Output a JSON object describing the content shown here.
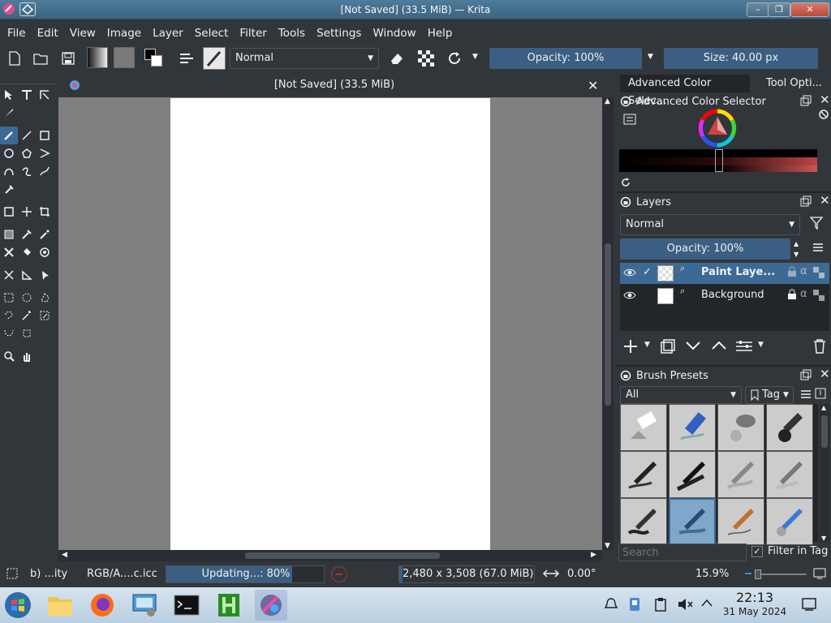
{
  "window": {
    "title": "[Not Saved] (33.5 MiB) — Krita",
    "controls": [
      "–",
      "❐",
      "✕"
    ]
  },
  "menu": [
    "File",
    "Edit",
    "View",
    "Image",
    "Layer",
    "Select",
    "Filter",
    "Tools",
    "Settings",
    "Window",
    "Help"
  ],
  "toolbar": {
    "blend_mode": "Normal",
    "opacity_label": "Opacity: 100%",
    "size_label": "Size: 40.00 px"
  },
  "document": {
    "tab_title": "[Not Saved]  (33.5 MiB)",
    "close": "✕"
  },
  "dockers": {
    "tabs": [
      "Advanced Color Selec...",
      "Tool Opti..."
    ],
    "color_selector_title": "Advanced Color Selector",
    "layers_title": "Layers",
    "layers_blend": "Normal",
    "layers_opacity": "Opacity:  100%",
    "layers": [
      {
        "name": "Paint Laye...",
        "selected": true
      },
      {
        "name": "Background",
        "selected": false
      }
    ],
    "brush_presets_title": "Brush Presets",
    "brush_filter": "All",
    "brush_tag": "Tag",
    "search_placeholder": "Search",
    "filter_in_tag": "Filter in Tag"
  },
  "statusbar": {
    "brush": "b) ...ity",
    "color_profile": "RGB/A....c.icc",
    "progress_label": "Updating...: 80%",
    "progress": 0.8,
    "image_size": "2,480 x 3,508 (67.0 MiB)",
    "rotation": "0.00°",
    "zoom": "15.9%"
  },
  "taskbar": {
    "time": "22:13",
    "date": "31 May 2024"
  },
  "colors": {
    "bg": "#31363b",
    "accent": "#3d6a94",
    "canvas_bg": "#808080"
  }
}
